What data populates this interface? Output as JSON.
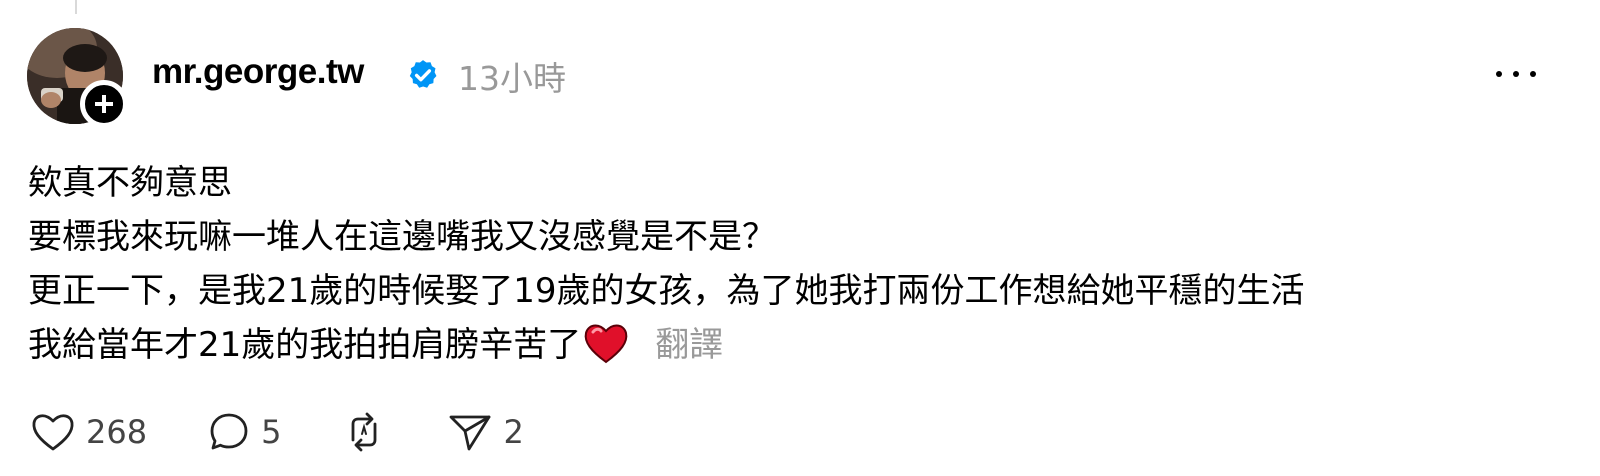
{
  "post": {
    "username": "mr.george.tw",
    "time_ago": "13小時",
    "lines": [
      "欸真不夠意思",
      "要標我來玩嘛一堆人在這邊嘴我又沒感覺是不是？",
      "更正一下，是我21歲的時候娶了19歲的女孩，為了她我打兩份工作想給她平穩的生活",
      "我給當年才21歲的我拍拍肩膀辛苦了"
    ],
    "translate_label": "翻譯"
  },
  "actions": {
    "likes": "268",
    "comments": "5",
    "shares": "2"
  },
  "colors": {
    "verified": "#0095f6",
    "secondary_text": "#999999",
    "emoji_heart": "#e0102a"
  },
  "icons": {
    "like": "heart-outline-icon",
    "comment": "speech-bubble-icon",
    "repost": "repost-icon",
    "share": "send-icon",
    "more": "more-horizontal-icon",
    "follow": "plus-icon",
    "verified": "verified-badge-icon"
  }
}
